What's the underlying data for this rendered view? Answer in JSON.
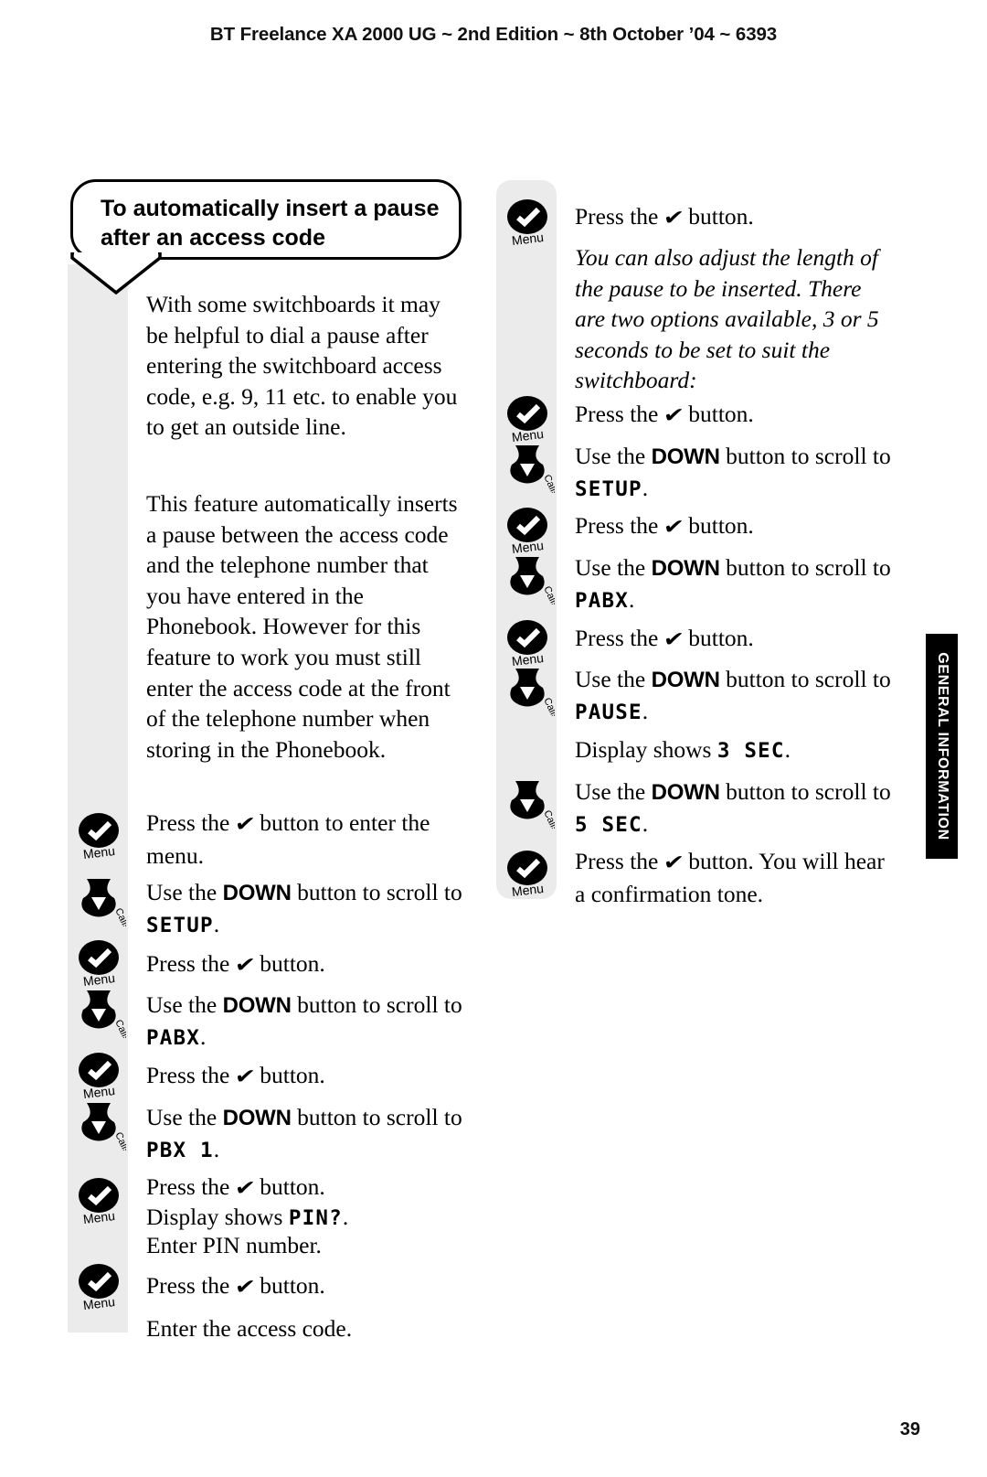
{
  "header": {
    "running_head": "BT Freelance XA 2000 UG ~ 2nd Edition ~ 8th October ’04 ~ 6393"
  },
  "folio": {
    "page_number": "39"
  },
  "thumb_tab": {
    "label": "GENERAL INFORMATION"
  },
  "callout": {
    "line1": "To automatically insert a pause",
    "line2": "after an access code"
  },
  "glyphs": {
    "check": "✔",
    "menu_label": "Menu",
    "calls_label": "Calls"
  },
  "left_column": {
    "para1": "With some switchboards it may be helpful to dial a pause after entering the switchboard access code, e.g. 9, 11 etc. to enable you to get an outside line.",
    "para2": "This feature automatically inserts a pause between the access code and the telephone number that you have entered in the Phonebook. However for this feature to work you must still enter the access code at the front of the telephone number when storing in the Phonebook.",
    "steps": [
      {
        "pre": "Press the ",
        "glyph": "✔",
        "post": " button to enter the menu."
      },
      {
        "pre": "Use the ",
        "strong": "DOWN",
        "mid": " button to scroll to ",
        "lcd": "SETUP",
        "post": "."
      },
      {
        "pre": "Press the ",
        "glyph": "✔",
        "post": " button."
      },
      {
        "pre": "Use the ",
        "strong": "DOWN",
        "mid": " button to scroll to ",
        "lcd": "PABX",
        "post": "."
      },
      {
        "pre": "Press the ",
        "glyph": "✔",
        "post": " button."
      },
      {
        "pre": "Use the ",
        "strong": "DOWN",
        "mid": " button to scroll to ",
        "lcd": "PBX  1",
        "post": "."
      },
      {
        "pre": "Press the ",
        "glyph": "✔",
        "post": " button."
      },
      {
        "pre": "Display shows ",
        "lcd": "PIN?",
        "post": "."
      },
      {
        "pre": "Enter PIN number."
      },
      {
        "pre": "Press the ",
        "glyph": "✔",
        "post": " button."
      },
      {
        "pre": "Enter the access code."
      }
    ]
  },
  "right_column": {
    "steps": [
      {
        "pre": "Press the ",
        "glyph": "✔",
        "post": " button."
      },
      {
        "italic": "You can also adjust the length of the pause to be inserted. There are two options available, 3 or 5 seconds to be set to suit the switchboard:"
      },
      {
        "pre": "Press the ",
        "glyph": "✔",
        "post": " button."
      },
      {
        "pre": "Use the ",
        "strong": "DOWN",
        "mid": " button to scroll to ",
        "lcd": "SETUP",
        "post": "."
      },
      {
        "pre": "Press the ",
        "glyph": "✔",
        "post": " button."
      },
      {
        "pre": "Use the ",
        "strong": "DOWN",
        "mid": " button to scroll to ",
        "lcd": "PABX",
        "post": "."
      },
      {
        "pre": "Press the ",
        "glyph": "✔",
        "post": " button."
      },
      {
        "pre": "Use the ",
        "strong": "DOWN",
        "mid": " button to scroll to ",
        "lcd": "PAUSE",
        "post": "."
      },
      {
        "pre": "Display shows ",
        "lcd": "3  SEC",
        "post": "."
      },
      {
        "pre": "Use the ",
        "strong": "DOWN",
        "mid": " button to scroll to ",
        "lcd": "5  SEC",
        "post": "."
      },
      {
        "pre": "Press the ",
        "glyph": "✔",
        "post": " button. You will hear a confirmation tone."
      }
    ]
  },
  "colors": {
    "rail_grey": "#ebebeb",
    "ink": "#000000",
    "tab_black": "#000000",
    "paper": "#ffffff"
  }
}
